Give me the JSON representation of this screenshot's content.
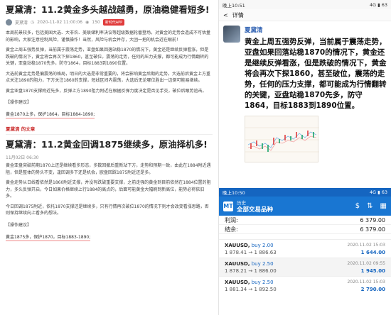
{
  "left": {
    "article1": {
      "title": "夏黛清：11.2黄金多头越战越勇，原油稳健看短多!",
      "author": "夏黛清",
      "datetime": "2020-11-02 11:00:06",
      "views": "150",
      "badge": "新时代APP",
      "paragraphs": [
        "本周前景较多，包括美国大选、大非农、美联储利率决议等超级数据轮番登场。对黄金的走势会造成不可估量的影响，大家注意控制风险，谨慎操作！当然，风险与机会并存，大团一把的机会近在眼前！",
        "黄金上周五强势反弹，当前属于震荡走势，亚盘如果回落站稳1870的情况下，黄金还是继续反弹看涨，但是跌破的情况下，黄金将会再次下探1860，甚至破位。震荡的走势，任何的压力支撑，都可能成为行情翻转的关键，亚盘站稳1870先多，防守1864，目标1883到1890位置。",
        "大选前黄金走势是偏震荡的格局，明日的大选是非常重要的，将会影响黄金后期的走势。大选前后黄金上方重点关注1890的阻力，下方关注1860的支撑，短线区间内震荡，大选后无论哪位胜出一边倒可能易继续。",
        "黄金亚盘1870支撑附近先多，反弹上方1890阻力附近在根据反弹力度决定是否见手交，破位后跟势追击。"
      ],
      "op_label": "【操作建议】",
      "op_text": "黄金1870上多，保护1864，目标1884-1890;"
    },
    "section_tag": "夏黛清 的文章",
    "article2": {
      "title": "夏黛清：11.2黄金回调1875继续多，原油择机多!",
      "datetime": "11月02日 06:30",
      "paragraphs": [
        "黄金亚盘突破前期1870上还是继续看多形态，多数回撤后重新站下方，走势和预期一致，由此在1884附近遇阻，但是整体的势头不变，逢回调多下还是机会，欧盘回踩1875附近还是多。",
        "黄金走势从日线看依然是1860附近支撑，并没有跌破重要支撑，之前走强的黄金到目前依然在1884位置的阻力，多头反弹开启，今日如果价格继续上行1884的高点的，后面可能黄金大幅刷到新高位，能势必将依旧多。",
        "今日回调1875附近，依托1870支撑还是继续多，只有行情再次破位1870的情况下则才会改变看涨思路，否则保持继续向上看多的想法。"
      ],
      "op_label": "【操作建议】",
      "op_text": "黄金1875多，保护1870，目标1883-1890;"
    }
  },
  "rtop": {
    "status_time": "晚上10:51",
    "status_right": "4G ▮ 63",
    "nav_back": "<",
    "nav_title": "详情",
    "author": "夏黛清",
    "text": "黄金上周五强势反弹，当前属于震荡走势，亚盘如果回落站稳1870的情况下，黄金还是继续反弹看涨，但是跌破的情况下，黄金将会再次下探1860，甚至破位，震荡的走势，任何的压力支撑，都可能成为行情翻转的关键，亚盘站稳1870先多，防守1864，目标1883到1890位置。"
  },
  "rbot": {
    "status_time": "晚上10:50",
    "status_right": "4G ▮ 63",
    "logo": "MT",
    "subtitle": "历史",
    "title": "全部交易品种",
    "balances": [
      {
        "label": "利润:",
        "value": "6 379.00"
      },
      {
        "label": "结余:",
        "value": "6 379.00"
      }
    ],
    "trades": [
      {
        "symbol": "XAUUSD,",
        "side": "buy 2.00",
        "date": "2020.11.02 15:03",
        "price": "1 878.41 → 1 886.63",
        "profit": "1 644.00"
      },
      {
        "symbol": "XAUUSD,",
        "side": "buy 2.50",
        "date": "2020.11.02 09:55",
        "price": "1 878.21 → 1 886.00",
        "profit": "1 945.00"
      },
      {
        "symbol": "XAUUSD,",
        "side": "buy 2.50",
        "date": "2020.11.02 15:03",
        "price": "1 881.34 → 1 892.50",
        "profit": "2 790.00"
      }
    ]
  }
}
